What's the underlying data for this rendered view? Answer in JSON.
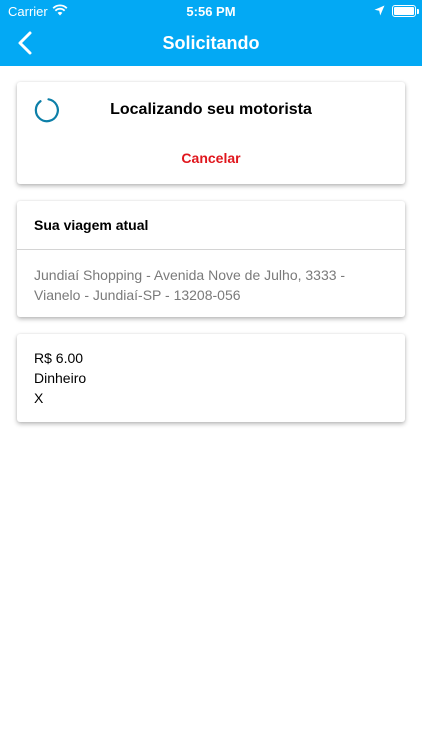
{
  "status_bar": {
    "carrier": "Carrier",
    "time": "5:56 PM",
    "icons": [
      "wifi-icon",
      "location-arrow-icon",
      "battery-icon"
    ]
  },
  "header": {
    "title": "Solicitando",
    "back_icon": "chevron-left-icon",
    "color": "#03A9F4"
  },
  "request_card": {
    "status": "Localizando seu motorista",
    "cancel_label": "Cancelar",
    "cancel_color": "#E0161D",
    "spinner_color": "#0D7FA8"
  },
  "trip_card": {
    "heading": "Sua viagem atual",
    "address": "Jundiaí Shopping - Avenida Nove de Julho, 3333 - Vianelo - Jundiaí-SP - 13208-056"
  },
  "payment_card": {
    "price": "R$ 6.00",
    "method": "Dinheiro",
    "extra": "X"
  }
}
